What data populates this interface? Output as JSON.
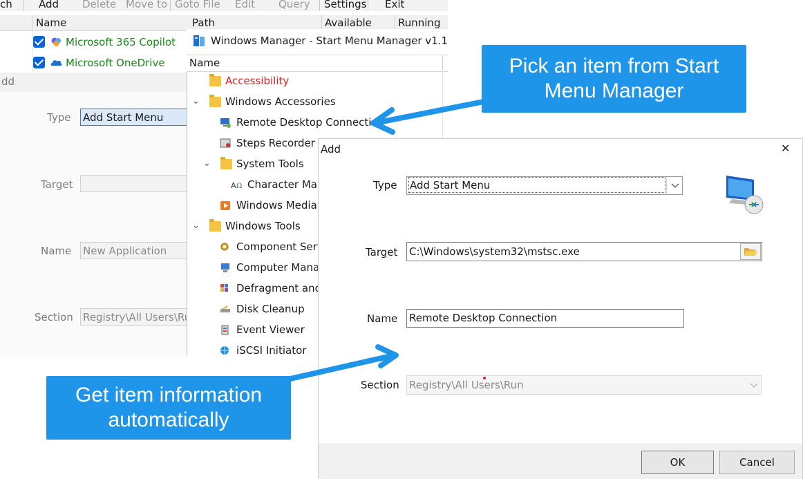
{
  "main_window": {
    "menu": {
      "item_0": "ch",
      "add": "Add",
      "delete": "Delete",
      "move_to": "Move to",
      "goto_file": "Goto File",
      "edit": "Edit",
      "query": "Query",
      "settings": "Settings",
      "exit": "Exit"
    },
    "columns": {
      "name": "Name",
      "path": "Path",
      "available": "Available",
      "running": "Running"
    },
    "rows": [
      {
        "name": "Microsoft 365 Copilot",
        "checked": true,
        "icon": "copilot-icon"
      },
      {
        "name": "Microsoft OneDrive",
        "checked": true,
        "icon": "onedrive-icon"
      }
    ]
  },
  "background_dialog": {
    "title": "dd",
    "type_label": "Type",
    "type_value": "Add Start Menu",
    "target_label": "Target",
    "target_value": "",
    "name_label": "Name",
    "name_value": "New Application",
    "section_label": "Section",
    "section_value": "Registry\\All Users\\Run"
  },
  "start_menu_manager": {
    "title": "Windows Manager - Start Menu Manager v1.1",
    "column_name": "Name",
    "items": [
      {
        "label": "Accessibility",
        "color": "#e02020",
        "icon": "folder-icon"
      },
      {
        "label": "Windows Accessories",
        "icon": "folder-icon",
        "expanded": true
      },
      {
        "label": "Remote Desktop Connection",
        "icon": "remote-desktop-icon"
      },
      {
        "label": "Steps Recorder",
        "icon": "steps-recorder-icon"
      },
      {
        "label": "System Tools",
        "icon": "folder-icon",
        "expanded": true
      },
      {
        "label": "Character Map",
        "icon": "character-map-icon"
      },
      {
        "label": "Windows Media P",
        "icon": "media-player-icon"
      },
      {
        "label": "Windows Tools",
        "icon": "folder-icon",
        "expanded": true
      },
      {
        "label": "Component Servi",
        "icon": "component-services-icon"
      },
      {
        "label": "Computer Manag",
        "icon": "computer-management-icon"
      },
      {
        "label": "Defragment and C",
        "icon": "defragment-icon"
      },
      {
        "label": "Disk Cleanup",
        "icon": "disk-cleanup-icon"
      },
      {
        "label": "Event Viewer",
        "icon": "event-viewer-icon"
      },
      {
        "label": "iSCSI Initiator",
        "icon": "iscsi-icon"
      }
    ]
  },
  "callouts": {
    "top": "Pick an item from Start Menu Manager",
    "bottom": "Get item information automatically",
    "color": "#1e95e8"
  },
  "add_dialog": {
    "title": "Add",
    "close": "✕",
    "type_label": "Type",
    "type_value": "Add Start Menu",
    "target_label": "Target",
    "target_value": "C:\\Windows\\system32\\mstsc.exe",
    "name_label": "Name",
    "name_value": "Remote Desktop Connection",
    "section_label": "Section",
    "section_value": "Registry\\All Users\\Run",
    "ok": "OK",
    "cancel": "Cancel"
  }
}
